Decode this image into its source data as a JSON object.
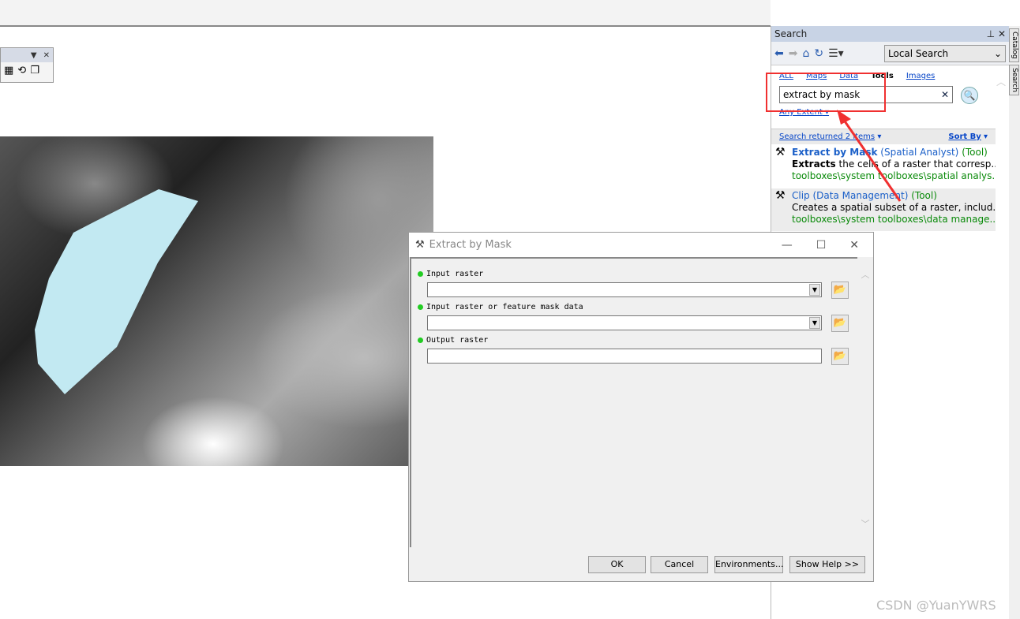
{
  "toolbar": {
    "icons": [
      "dropdown-icon",
      "close-icon",
      "layout-icon",
      "refresh-layout-icon",
      "pages-icon"
    ]
  },
  "search_panel": {
    "title": "Search",
    "pin": "⊥",
    "close": "✕",
    "scope": "Local Search",
    "categories": [
      {
        "label": "ALL"
      },
      {
        "label": "Maps"
      },
      {
        "label": "Data"
      },
      {
        "label": "Tools",
        "active": true
      },
      {
        "label": "Images"
      }
    ],
    "query": "extract by mask",
    "extent": "Any Extent",
    "results_summary": "Search returned 2 items",
    "sort_by": "Sort By",
    "results": [
      {
        "title": "Extract by Mask",
        "toolbox": "(Spatial Analyst)",
        "kind": "(Tool)",
        "desc_bold": "Extracts",
        "desc": " the cells of a raster that corresp...",
        "path": "toolboxes\\system toolboxes\\spatial analys..."
      },
      {
        "title": "Clip",
        "toolbox": "(Data Management)",
        "kind": "(Tool)",
        "desc_bold": "",
        "desc": "Creates a spatial subset of a raster, includ...",
        "path": "toolboxes\\system toolboxes\\data manage..."
      }
    ]
  },
  "side_tabs": [
    "Catalog",
    "Search"
  ],
  "dialog": {
    "title": "Extract by Mask",
    "params": [
      {
        "label": "Input raster",
        "value": ""
      },
      {
        "label": "Input raster or feature mask data",
        "value": ""
      },
      {
        "label": "Output raster",
        "value": ""
      }
    ],
    "buttons": {
      "ok": "OK",
      "cancel": "Cancel",
      "env": "Environments...",
      "help": "Show Help >>"
    }
  },
  "highlight_color": "#f03030",
  "mask_polygon_color": "#c2e9f2",
  "watermark": "CSDN @YuanYWRS"
}
